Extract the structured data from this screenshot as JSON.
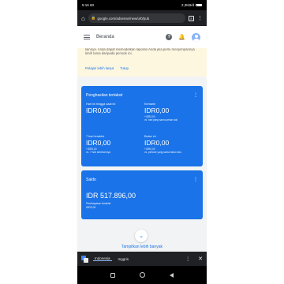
{
  "status_bar": {
    "time": "5:16 60",
    "right_text": "2,3KB/d",
    "battery_icon": "battery-icon"
  },
  "browser": {
    "url": "google.com/adsense/new/u/0/pub",
    "tab_count": "8",
    "home_icon": "home-icon",
    "menu_icon": "more-vert-icon"
  },
  "app_bar": {
    "title": "Beranda",
    "help_icon": "help-icon",
    "notification_icon": "bell-icon"
  },
  "notice": {
    "text": "lainnya. Anda dapat memodelkan laporan Anda jika perlu menyimpannya lebih lama daripada periode ini.",
    "learn_more_label": "Pelajari lebih lanjut",
    "close_label": "Tutup"
  },
  "earnings_card": {
    "title": "Penghasilan tertaksir",
    "metrics": [
      {
        "label": "Hari ini hingga saat ini",
        "value": "IDR0,00",
        "delta": "",
        "compare": ""
      },
      {
        "label": "Kemarin",
        "value": "IDR0,00",
        "delta": "+IDR0,00",
        "compare": "vs. hari yang sama pekan lalu"
      },
      {
        "label": "7 hari terakhir",
        "value": "IDR0,00",
        "delta": "+IDR0,00",
        "compare": "vs. 7 hari sebelumnya"
      },
      {
        "label": "Bulan ini",
        "value": "IDR0,00",
        "delta": "+IDR0,00",
        "compare": "vs. periode yang sama tahun lalu"
      }
    ]
  },
  "balance_card": {
    "title": "Saldo",
    "value": "IDR 517.896,00",
    "last_payment_label": "Pembayaran terakhir",
    "last_payment_value": "IDR0,00"
  },
  "show_more_label": "Tampilkan lebih banyak",
  "translate_bar": {
    "lang_active": "Indonesia",
    "lang_other": "Inggris"
  },
  "colors": {
    "primary": "#1a73e8",
    "notice_bg": "#fef7e0",
    "page_bg": "#f1f3f4"
  }
}
